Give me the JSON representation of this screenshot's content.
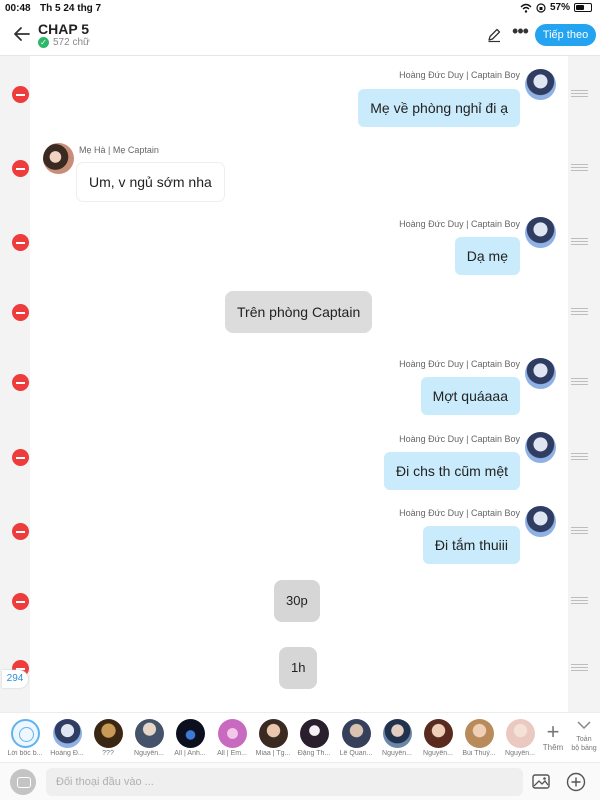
{
  "status_bar": {
    "time": "00:48",
    "date": "Th 5 24 thg 7",
    "battery": "57%",
    "battery_level": 0.57
  },
  "header": {
    "title": "CHAP 5",
    "word_count": "572 chữ",
    "continue_label": "Tiếp theo",
    "icons": [
      "back-arrow-icon",
      "edit-pencil-icon",
      "more-icon"
    ]
  },
  "messages": [
    {
      "kind": "right",
      "sender": "Hoàng Đức Duy | Captain Boy",
      "text": "Mẹ về phòng nghỉ đi ạ"
    },
    {
      "kind": "left",
      "sender": "Mẹ Hà | Mẹ Captain",
      "text": "Um, v ngủ sớm nha"
    },
    {
      "kind": "right",
      "sender": "Hoàng Đức Duy | Captain Boy",
      "text": "Dạ mẹ"
    },
    {
      "kind": "center",
      "text": "Trên phòng Captain"
    },
    {
      "kind": "right",
      "sender": "Hoàng Đức Duy | Captain Boy",
      "text": "Mợt quáaaa"
    },
    {
      "kind": "right",
      "sender": "Hoàng Đức Duy | Captain Boy",
      "text": "Đi chs th cũm mệt"
    },
    {
      "kind": "right",
      "sender": "Hoàng Đức Duy | Captain Boy",
      "text": "Đi tắm thuiii"
    },
    {
      "kind": "center",
      "text": "30p"
    },
    {
      "kind": "center",
      "text": "1h"
    }
  ],
  "message_counter": "294",
  "characters": [
    {
      "name": "Lời bốc b..."
    },
    {
      "name": "Hoàng Đ..."
    },
    {
      "name": "???"
    },
    {
      "name": "Nguyễn..."
    },
    {
      "name": "All | Anh..."
    },
    {
      "name": "All | Em..."
    },
    {
      "name": "Miaa | Tg..."
    },
    {
      "name": "Đặng Th..."
    },
    {
      "name": "Lê Quan..."
    },
    {
      "name": "Nguyễn..."
    },
    {
      "name": "Nguyễn..."
    },
    {
      "name": "Bùi Thuỳ..."
    },
    {
      "name": "Nguyễn..."
    }
  ],
  "add_character_label": "Thêm",
  "all_label_line1": "Toàn",
  "all_label_line2": "bộ bảng",
  "input": {
    "placeholder": "Đối thoại đầu vào ..."
  },
  "colors": {
    "accent": "#23a3f0",
    "my_bubble": "#c9ebfb",
    "delete": "#ee3b3b",
    "narration": "#dcdcdc"
  }
}
